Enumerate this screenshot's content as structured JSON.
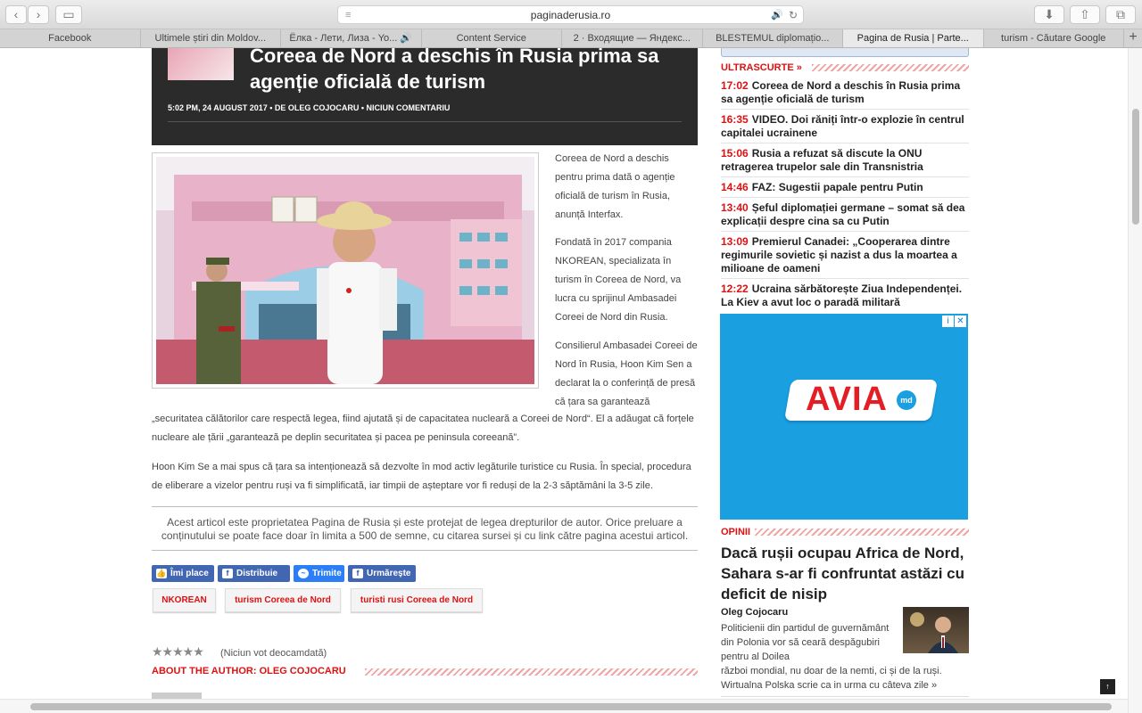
{
  "browser": {
    "url": "paginaderusia.ro",
    "tabs": [
      {
        "label": "Facebook",
        "active": false
      },
      {
        "label": "Ultimele știri din Moldov...",
        "active": false
      },
      {
        "label": "Ёлка - Лети, Лиза - Yo... 🔊",
        "active": false
      },
      {
        "label": "Content Service",
        "active": false
      },
      {
        "label": "2 · Входящие — Яндекс...",
        "active": false
      },
      {
        "label": "BLESTEMUL diplomațio...",
        "active": false
      },
      {
        "label": "Pagina de Rusia | Parte...",
        "active": true
      },
      {
        "label": "turism - Căutare Google",
        "active": false
      }
    ],
    "new_tab": "+"
  },
  "article": {
    "title": "Coreea de Nord a deschis în Rusia prima sa agenție oficială de turism",
    "meta": "5:02 PM, 24 AUGUST 2017 • DE OLEG COJOCARU • NICIUN COMENTARIU",
    "paragraphs": [
      "Coreea de Nord a deschis pentru prima dată o agenție oficială de turism în Rusia, anunță Interfax.",
      "Fondată în 2017 compania NKOREAN, specializata în turism în Coreea de Nord, va lucra cu sprijinul Ambasadei Coreei de Nord din Rusia.",
      "Consilierul Ambasadei Coreei de Nord în Rusia, Hoon Kim Sen a declarat la o conferință de presă că țara sa garantează",
      "„securitatea călătorilor care respectă legea, fiind ajutată și de capacitatea nucleară a Coreei de Nord“. El a adăugat că forțele nucleare ale țării „garantează pe deplin securitatea și pacea pe peninsula coreeană”.",
      "Hoon Kim Se a mai spus că țara sa intenționează să dezvolte în mod activ legăturile turistice cu Rusia. În special, procedura de eliberare a vizelor pentru ruși va fi simplificată, iar timpii de așteptare vor fi reduși de la 2-3 săptămâni la 3-5 zile."
    ],
    "copyright_notice": "Acest articol este proprietatea Pagina de Rusia și este protejat de legea drepturilor de autor. Orice preluare a conținutului se poate face doar în limita a 500 de semne, cu citarea sursei și cu link către pagina acestui articol.",
    "share": {
      "like": "Îmi place",
      "share": "Distribuie",
      "share_count": "1",
      "send": "Trimite",
      "follow": "Urmărește"
    },
    "tags": [
      "NKOREAN",
      "turism Coreea de Nord",
      "turisti rusi Coreea de Nord"
    ],
    "rating_stars": "★★★★★",
    "rating_text": "(Niciun vot deocamdată)",
    "about_author": "ABOUT THE AUTHOR: OLEG COJOCARU"
  },
  "sidebar": {
    "ultrascurte_label": "ULTRASCURTE »",
    "news": [
      {
        "time": "17:02",
        "text": "Coreea de Nord a deschis în Rusia prima sa agenție oficială de turism"
      },
      {
        "time": "16:35",
        "text": "VIDEO. Doi răniți într-o explozie în centrul capitalei ucrainene"
      },
      {
        "time": "15:06",
        "text": "Rusia a refuzat să discute la ONU retragerea trupelor sale din Transnistria"
      },
      {
        "time": "14:46",
        "text": "FAZ: Sugestii papale pentru Putin"
      },
      {
        "time": "13:40",
        "text": "Șeful diplomației germane – somat să dea explicații despre cina sa cu Putin"
      },
      {
        "time": "13:09",
        "text": "Premierul Canadei: „Cooperarea dintre regimurile sovietic și nazist a dus la moartea a milioane de oameni"
      },
      {
        "time": "12:22",
        "text": "Ucraina sărbătorește Ziua Independenței. La Kiev a avut loc o paradă militară"
      }
    ],
    "ad": {
      "brand": "AVIA",
      "suffix": "md",
      "info": "i",
      "close": "✕"
    },
    "opinii_label": "OPINII",
    "opinion": {
      "title": "Dacă rușii ocupau Africa de Nord, Sahara s-ar fi confruntat astăzi cu deficit de nisip",
      "author": "Oleg Cojocaru",
      "text_side": "Politicienii din partidul de guvernământ din Polonia vor să ceară despăgubiri pentru al Doilea",
      "text_full": "război mondial, nu doar de la nemti, ci și de la ruși. Wirtualna Polska scrie ca in urma cu câteva zile »"
    }
  },
  "back_to_top": "↑",
  "colors": {
    "accent": "#dd1111",
    "hero_bg": "#2b2b2b",
    "ad_bg": "#1aa0e1",
    "fb_blue": "#3b5998"
  }
}
